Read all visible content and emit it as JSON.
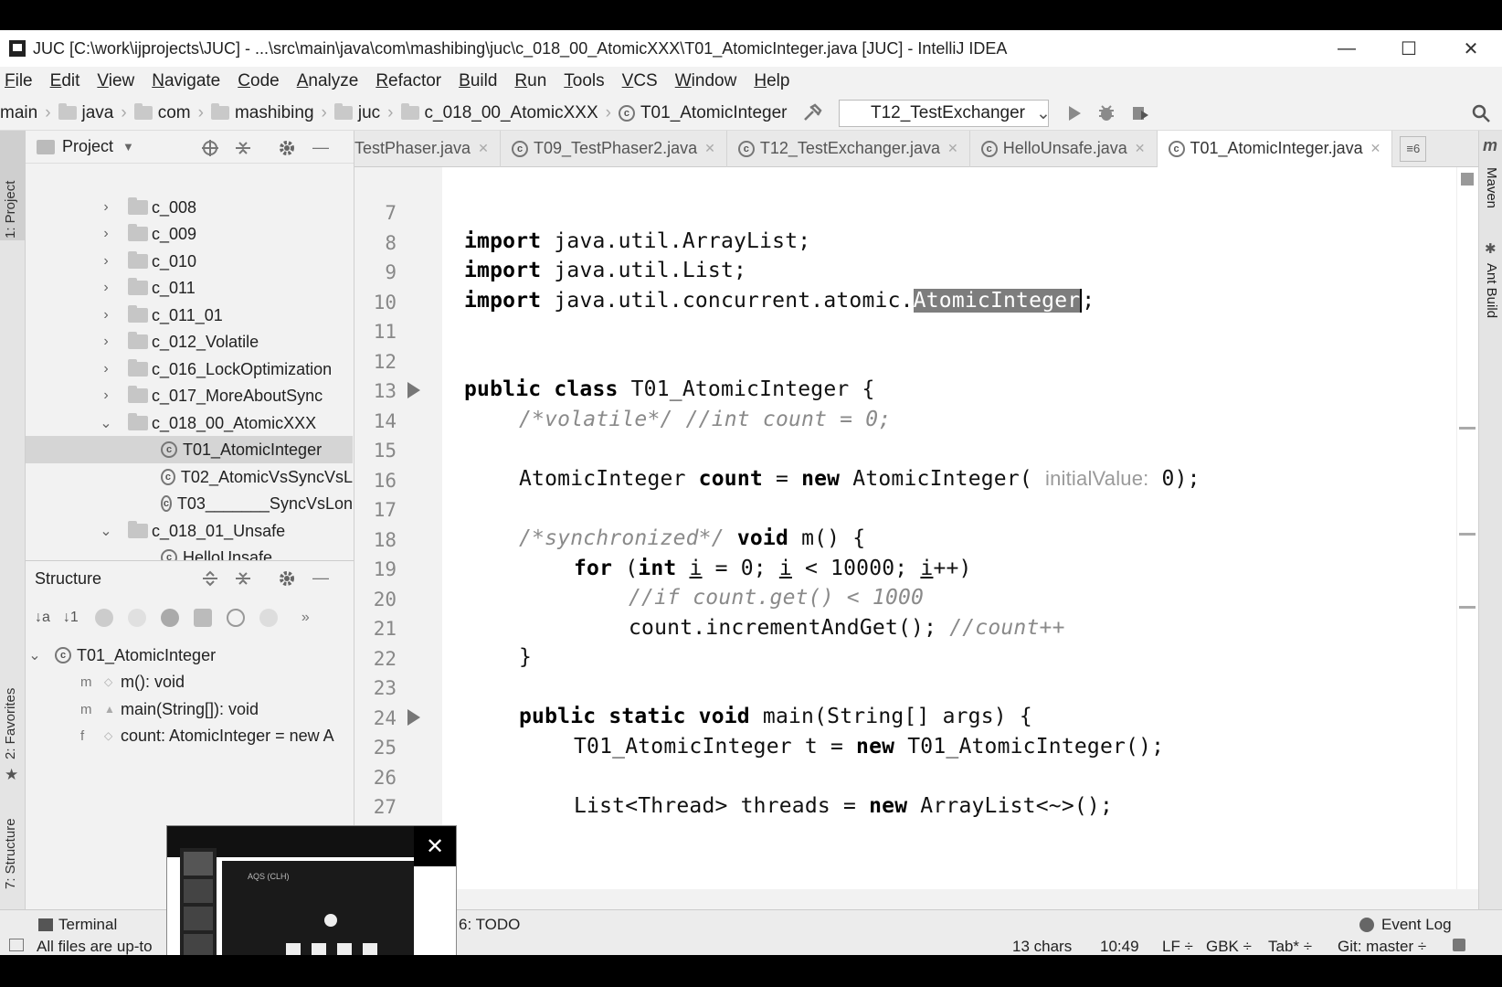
{
  "window": {
    "title": "JUC [C:\\work\\ijprojects\\JUC] - ...\\src\\main\\java\\com\\mashibing\\juc\\c_018_00_AtomicXXX\\T01_AtomicInteger.java [JUC] - IntelliJ IDEA",
    "minimize": "—",
    "maximize": "☐",
    "close": "✕"
  },
  "menu": [
    "File",
    "Edit",
    "View",
    "Navigate",
    "Code",
    "Analyze",
    "Refactor",
    "Build",
    "Run",
    "Tools",
    "VCS",
    "Window",
    "Help"
  ],
  "breadcrumb": [
    "main",
    "java",
    "com",
    "mashibing",
    "juc",
    "c_018_00_AtomicXXX",
    "T01_AtomicInteger"
  ],
  "run_config": "T12_TestExchanger",
  "left_stripe": {
    "project": "1: Project",
    "favorites": "2: Favorites",
    "structure": "7: Structure"
  },
  "right_stripe": {
    "maven": "Maven",
    "ant": "Ant Build",
    "m": "m"
  },
  "project_panel": {
    "title": "Project",
    "items": [
      {
        "label": "c_008",
        "arrow": "›"
      },
      {
        "label": "c_009",
        "arrow": "›"
      },
      {
        "label": "c_010",
        "arrow": "›"
      },
      {
        "label": "c_011",
        "arrow": "›"
      },
      {
        "label": "c_011_01",
        "arrow": "›"
      },
      {
        "label": "c_012_Volatile",
        "arrow": "›"
      },
      {
        "label": "c_016_LockOptimization",
        "arrow": "›"
      },
      {
        "label": "c_017_MoreAboutSync",
        "arrow": "›"
      },
      {
        "label": "c_018_00_AtomicXXX",
        "arrow": "⌄"
      },
      {
        "label": "T01_AtomicInteger"
      },
      {
        "label": "T02_AtomicVsSyncVsL"
      },
      {
        "label": "T03_______SyncVsLon"
      },
      {
        "label": "c_018_01_Unsafe",
        "arrow": "⌄"
      },
      {
        "label": "HelloUnsafe"
      }
    ]
  },
  "structure_panel": {
    "title": "Structure",
    "more": "»",
    "items": [
      {
        "label": "T01_AtomicInteger",
        "arrow": "⌄"
      },
      {
        "label": "m(): void",
        "badge": "m"
      },
      {
        "label": "main(String[]): void",
        "badge": "m"
      },
      {
        "label": "count: AtomicInteger = new A",
        "badge": "f"
      }
    ]
  },
  "tabs": [
    {
      "label": "TestPhaser.java"
    },
    {
      "label": "T09_TestPhaser2.java"
    },
    {
      "label": "T12_TestExchanger.java"
    },
    {
      "label": "HelloUnsafe.java"
    },
    {
      "label": "T01_AtomicInteger.java"
    }
  ],
  "tabs_overflow": "≡6",
  "line_numbers": [
    "7",
    "8",
    "9",
    "10",
    "11",
    "12",
    "13",
    "14",
    "15",
    "16",
    "17",
    "18",
    "19",
    "20",
    "21",
    "22",
    "23",
    "24",
    "25",
    "26",
    "27"
  ],
  "code": {
    "l8": {
      "kw": "import",
      "rest": " java.util.ArrayList;"
    },
    "l9": {
      "kw": "import",
      "rest": " java.util.List;"
    },
    "l10": {
      "kw": "import",
      "rest": " java.util.concurrent.atomic.",
      "hl": "AtomicInteger",
      "end": ";"
    },
    "l13": {
      "kw": "public class",
      "rest": " T01_AtomicInteger {"
    },
    "l14": {
      "cm": "/*volatile*/ //int count = 0;"
    },
    "l16": {
      "a": "AtomicInteger ",
      "b": "count",
      "c": " = ",
      "kw": "new",
      "d": " AtomicInteger( ",
      "hint": "initialValue:",
      "e": " 0);"
    },
    "l18": {
      "cm": "/*synchronized*/",
      "kw": " void",
      "rest": " m() {"
    },
    "l19": {
      "kw": "for",
      "a": " (",
      "kw2": "int",
      "b": " ",
      "i1": "i",
      "c": " = 0; ",
      "i2": "i",
      "d": " < 10000; ",
      "i3": "i",
      "e": "++)"
    },
    "l20": {
      "cm": "//if count.get() < 1000"
    },
    "l21": {
      "rest": "count.incrementAndGet(); ",
      "cm": "//count++"
    },
    "l22": {
      "rest": "}"
    },
    "l24": {
      "kw": "public static void",
      "rest": " main(String[] args) {"
    },
    "l25": {
      "a": "T01_AtomicInteger t = ",
      "kw": "new",
      "b": " T01_AtomicInteger();"
    },
    "l27": {
      "a": "List<Thread> threads = ",
      "kw": "new",
      "b": " ArrayList<~>();"
    }
  },
  "bottom_tools": {
    "terminal": "Terminal",
    "todo": "6: TODO",
    "event_log": "Event Log"
  },
  "status": {
    "message": "All files are up-to",
    "chars": "13 chars",
    "position": "10:49",
    "line_sep": "LF ÷",
    "encoding": "GBK ÷",
    "indent": "Tab* ÷",
    "git": "Git: master ÷"
  },
  "popup": {
    "close": "✕",
    "inner_label": "AQS (CLH)"
  }
}
